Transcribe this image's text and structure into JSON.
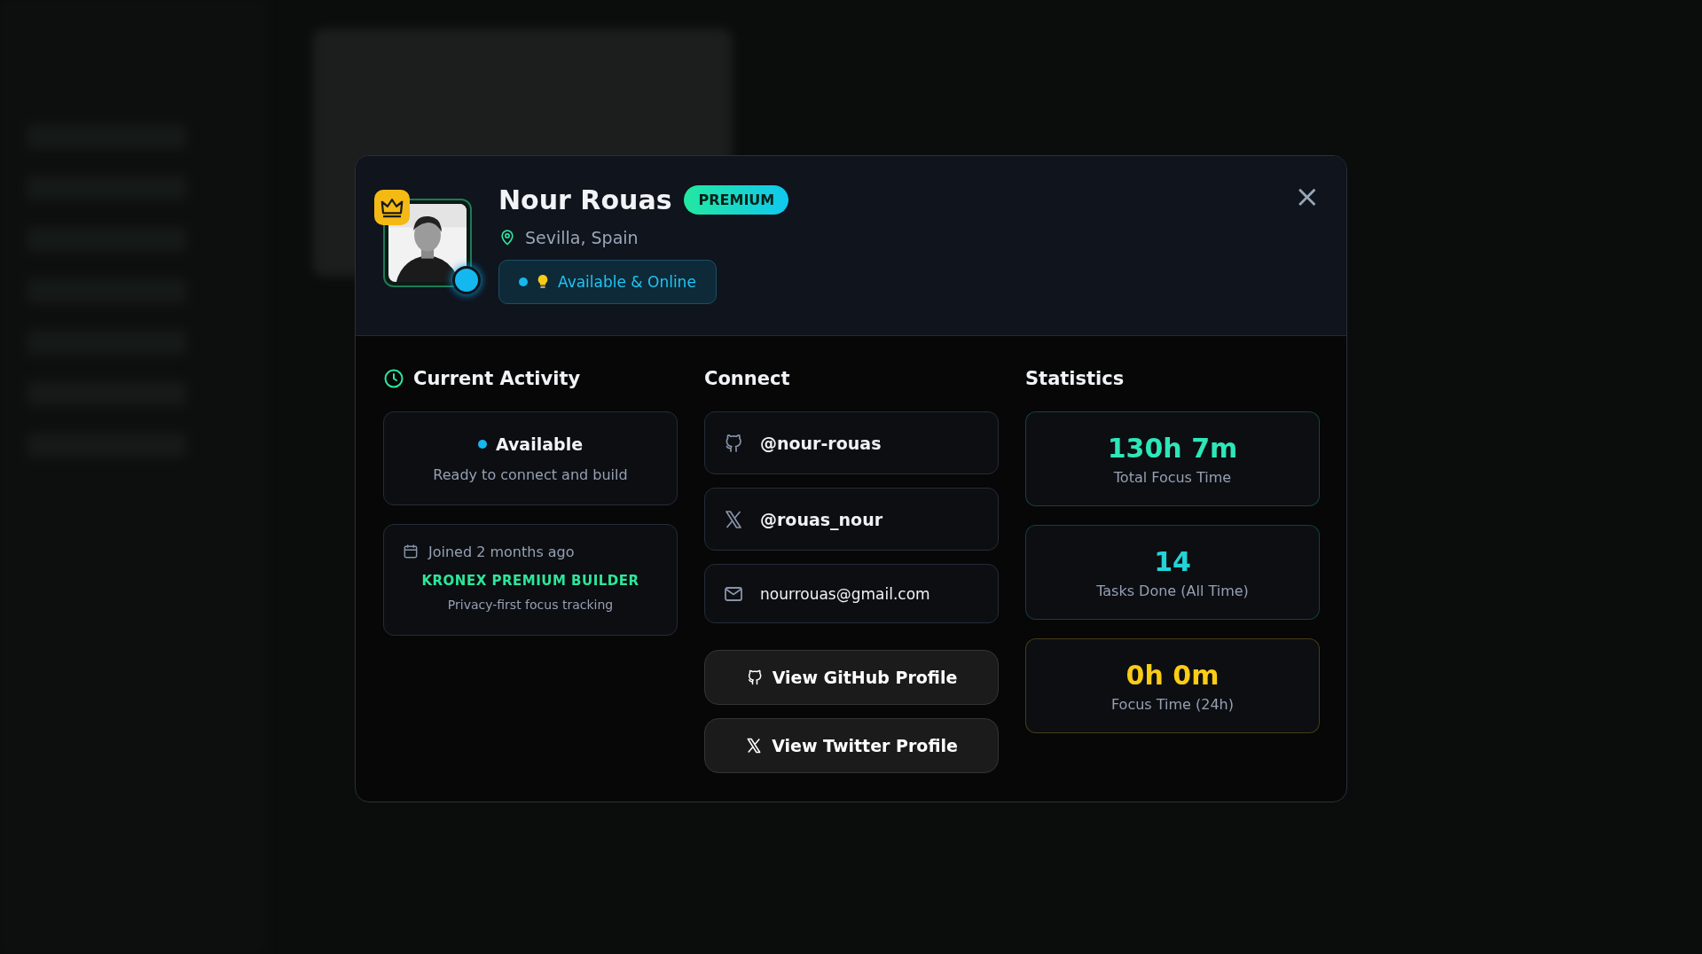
{
  "profile": {
    "name": "Nour Rouas",
    "badge": "PREMIUM",
    "location": "Sevilla, Spain",
    "status": "Available & Online",
    "online": true,
    "premium": true
  },
  "close": "×",
  "activity": {
    "title": "Current Activity",
    "state": "Available",
    "description": "Ready to connect and build",
    "joined": "Joined 2 months ago",
    "tier": "KRONEX PREMIUM BUILDER",
    "tagline": "Privacy-first focus tracking"
  },
  "connect": {
    "title": "Connect",
    "links": [
      {
        "kind": "github",
        "text": "@nour-rouas"
      },
      {
        "kind": "x",
        "text": "@rouas_nour"
      },
      {
        "kind": "email",
        "text": "nourrouas@gmail.com"
      }
    ],
    "buttons": [
      {
        "kind": "github",
        "label": "View GitHub Profile"
      },
      {
        "kind": "x",
        "label": "View Twitter Profile"
      }
    ]
  },
  "statistics": {
    "title": "Statistics",
    "items": [
      {
        "value": "130h 7m",
        "label": "Total Focus Time",
        "color": "#2ee6b8"
      },
      {
        "value": "14",
        "label": "Tasks Done (All Time)",
        "color": "#22d3d8"
      },
      {
        "value": "0h 0m",
        "label": "Focus Time (24h)",
        "color": "#facc15"
      }
    ]
  }
}
